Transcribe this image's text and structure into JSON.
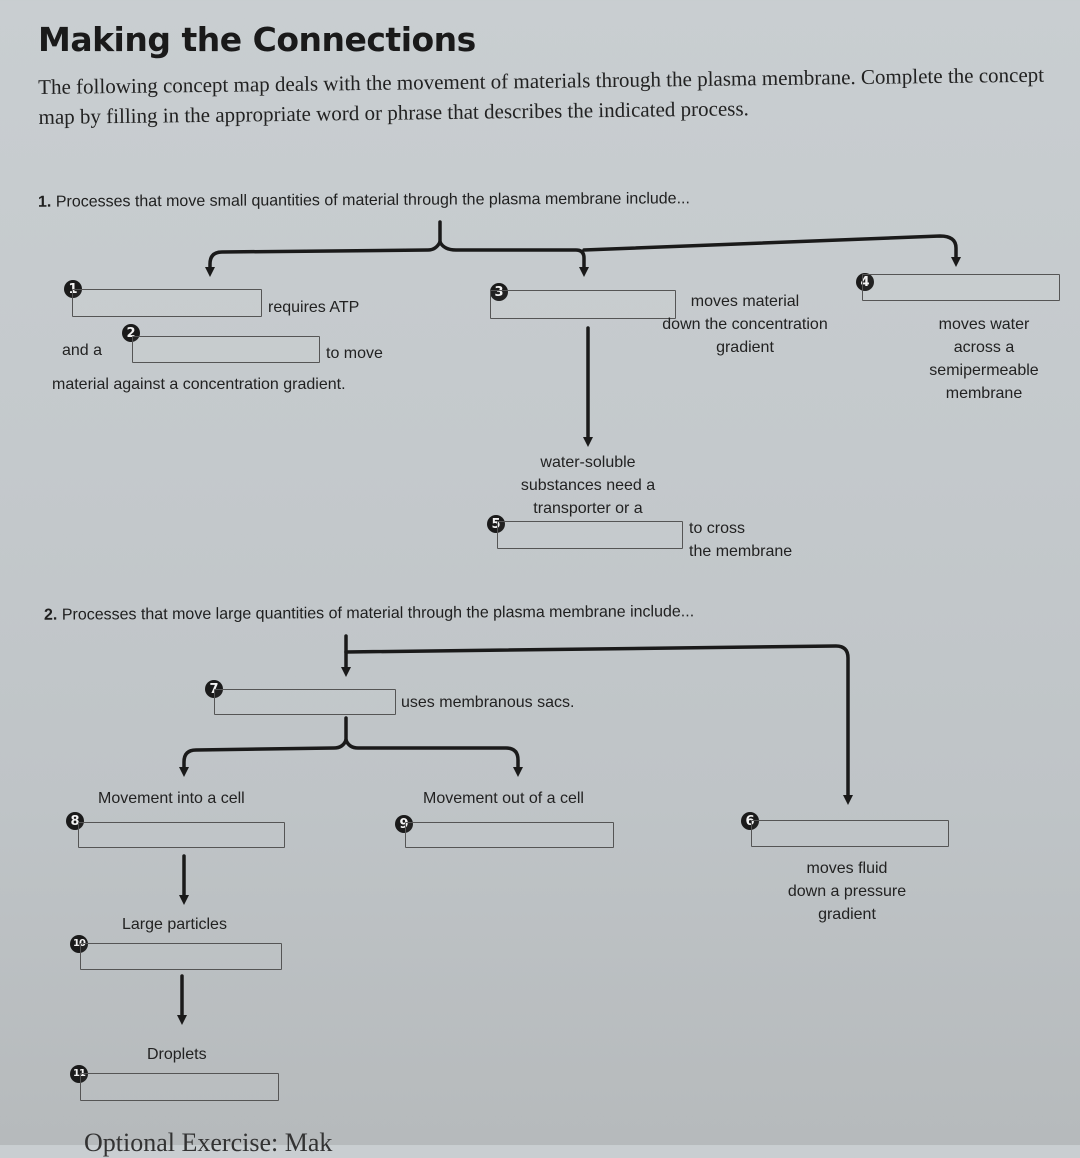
{
  "title": "Making the Connections",
  "intro": "The following concept map deals with the movement of materials through the plasma membrane. Complete the concept map by filling in the appropriate word or phrase that describes the indicated process.",
  "section1": {
    "number": "1.",
    "prompt": "Processes that move small quantities of material through the plasma membrane include...",
    "blanks": [
      {
        "number": "1",
        "answer": "",
        "after_text": "requires ATP"
      },
      {
        "number": "2",
        "answer": "",
        "before_text": "and a",
        "after_text": "to move",
        "continuation": "material against a concentration gradient."
      },
      {
        "number": "3",
        "answer": "",
        "side_text": [
          "moves material",
          "down the concentration",
          "gradient"
        ]
      },
      {
        "number": "4",
        "answer": "",
        "below_text": [
          "moves water",
          "across a",
          "semipermeable",
          "membrane"
        ]
      },
      {
        "number": "5",
        "answer": "",
        "above_text": [
          "water-soluble",
          "substances need a",
          "transporter or a"
        ],
        "after_text": [
          "to cross",
          "the membrane"
        ]
      }
    ]
  },
  "section2": {
    "number": "2.",
    "prompt": "Processes that move large quantities of material through the plasma membrane include...",
    "blanks": [
      {
        "number": "7",
        "answer": "",
        "after_text": "uses membranous sacs."
      },
      {
        "number": "8",
        "answer": "",
        "above_text": "Movement into a cell"
      },
      {
        "number": "9",
        "answer": "",
        "above_text": "Movement out of a cell"
      },
      {
        "number": "6",
        "answer": "",
        "below_text": [
          "moves fluid",
          "down a pressure",
          "gradient"
        ]
      },
      {
        "number": "10",
        "answer": "",
        "above_text": "Large particles"
      },
      {
        "number": "11",
        "answer": "",
        "above_text": "Droplets"
      }
    ]
  },
  "footer_cutoff": "Optional Exercise: Mak"
}
